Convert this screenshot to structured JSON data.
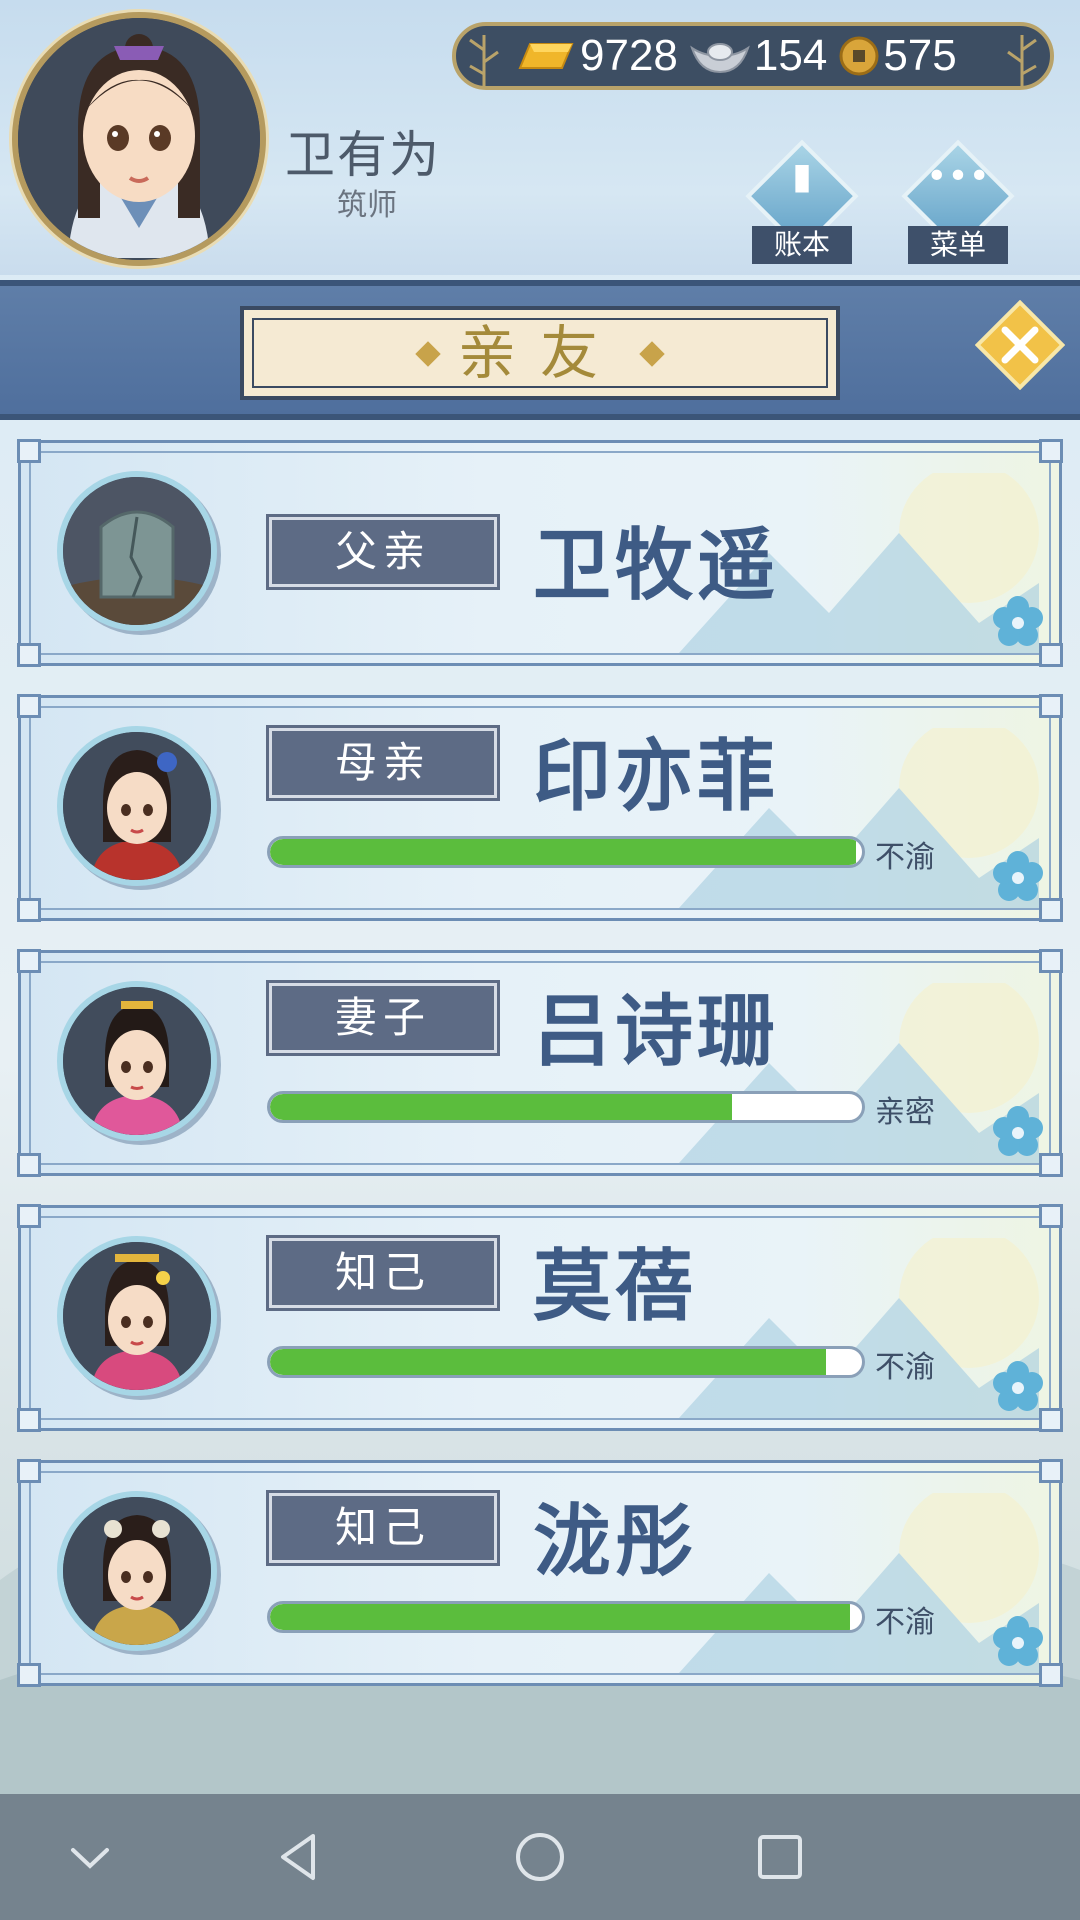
{
  "player": {
    "name": "卫有为",
    "title": "筑师"
  },
  "currency": {
    "gold": "9728",
    "silver": "154",
    "copper": "575",
    "icons": [
      "gold-ingot-icon",
      "silver-ingot-icon",
      "copper-coin-icon"
    ]
  },
  "header_buttons": {
    "ledger": "账本",
    "menu": "菜单"
  },
  "panel": {
    "title": "亲友"
  },
  "relatives": [
    {
      "relation": "父亲",
      "name": "卫牧遥",
      "affection": null,
      "status": ""
    },
    {
      "relation": "母亲",
      "name": "印亦菲",
      "affection": 0.99,
      "status": "不渝"
    },
    {
      "relation": "妻子",
      "name": "吕诗珊",
      "affection": 0.78,
      "status": "亲密"
    },
    {
      "relation": "知己",
      "name": "莫蓓",
      "affection": 0.94,
      "status": "不渝"
    },
    {
      "relation": "知己",
      "name": "泷彤",
      "affection": 0.98,
      "status": "不渝"
    }
  ],
  "colors": {
    "bar_fill": "#5bbd3d",
    "name_text": "#3e5b85",
    "tag_bg": "#5d6b85",
    "title_text": "#a48a3a",
    "navbar": "#75838e"
  }
}
